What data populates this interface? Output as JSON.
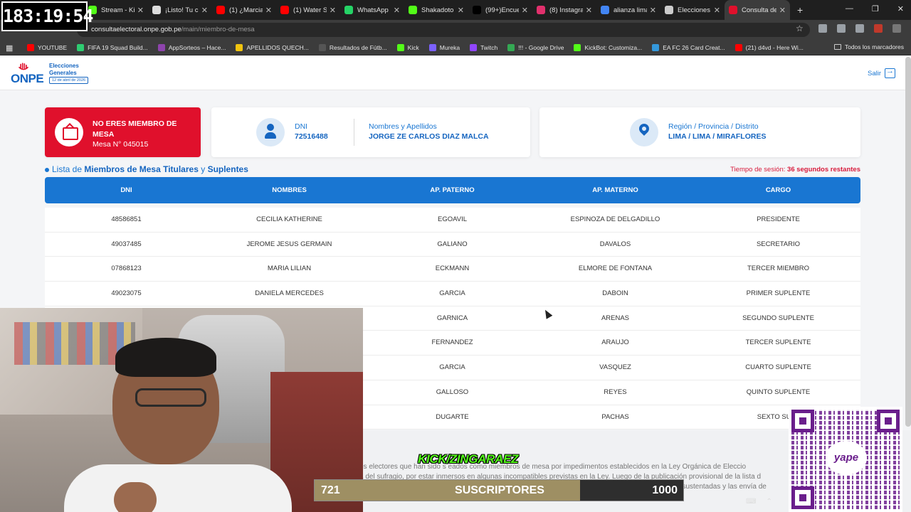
{
  "overlay": {
    "timer": "183:19:54",
    "kick_handle": "KICK/ZINGARAEZ",
    "subs_current": "721",
    "subs_label": "SUSCRIPTORES",
    "subs_goal": "1000",
    "subs_progress_fraction": 0.721,
    "qr_brand": "yape"
  },
  "browser": {
    "tabs": [
      {
        "label": "Stream - Kic",
        "color": "#53fc18"
      },
      {
        "label": "¡Listo! Tu cu",
        "color": "#dddddd"
      },
      {
        "label": "(1) ¿Marcian",
        "color": "#ff0000"
      },
      {
        "label": "(1) Water Sli",
        "color": "#ff0000"
      },
      {
        "label": "WhatsApp |",
        "color": "#25d366"
      },
      {
        "label": "Shakadoto S",
        "color": "#53fc18"
      },
      {
        "label": "(99+)Encuen",
        "color": "#000000"
      },
      {
        "label": "(8) Instagran",
        "color": "#e1306c"
      },
      {
        "label": "alianza lima",
        "color": "#4285f4"
      },
      {
        "label": "Elecciones G",
        "color": "#cccccc"
      },
      {
        "label": "Consulta de",
        "color": "#e0102c",
        "active": true
      }
    ],
    "new_tab": "+",
    "url_domain": "consultaelectoral.onpe.gob.pe",
    "url_path": "/main/miembro-de-mesa",
    "bookmarks": [
      {
        "label": "YOUTUBE",
        "color": "#ff0000"
      },
      {
        "label": "FIFA 19 Squad Build...",
        "color": "#2ecc71"
      },
      {
        "label": "AppSorteos – Hace...",
        "color": "#8e44ad"
      },
      {
        "label": "APELLIDOS QUECH...",
        "color": "#f1c40f"
      },
      {
        "label": "Resultados de Fútb...",
        "color": "#555555"
      },
      {
        "label": "Kick",
        "color": "#53fc18"
      },
      {
        "label": "Mureka",
        "color": "#7b61ff"
      },
      {
        "label": "Twitch",
        "color": "#9146ff"
      },
      {
        "label": "!!! - Google Drive",
        "color": "#34a853"
      },
      {
        "label": "KickBot: Customiza...",
        "color": "#53fc18"
      },
      {
        "label": "EA FC 26 Card Creat...",
        "color": "#3498db"
      },
      {
        "label": "(21) d4vd - Here Wi...",
        "color": "#ff0000"
      }
    ],
    "all_bookmarks": "Todos los marcadores"
  },
  "header": {
    "brand": "ONPE",
    "elections_title": "Elecciones Generales",
    "elections_date": "12 de abril de 2026",
    "logout": "Salir"
  },
  "status_card": {
    "title": "NO ERES MIEMBRO DE MESA",
    "mesa": "Mesa N° 045015"
  },
  "person_card": {
    "dni_label": "DNI",
    "dni_value": "72516488",
    "name_label": "Nombres y Apellidos",
    "name_value": "JORGE ZE CARLOS DIAZ MALCA"
  },
  "location_card": {
    "label": "Región / Provincia / Distrito",
    "value": "LIMA / LIMA / MIRAFLORES"
  },
  "list": {
    "title_prefix": "Lista de",
    "title_bold1": "Miembros de Mesa Titulares",
    "title_mid": "y",
    "title_bold2": "Suplentes",
    "session_prefix": "Tiempo de sesión:",
    "session_value": "36 segundos restantes"
  },
  "table": {
    "columns": [
      "DNI",
      "NOMBRES",
      "AP. PATERNO",
      "AP. MATERNO",
      "CARGO"
    ],
    "rows": [
      [
        "48586851",
        "CECILIA KATHERINE",
        "EGOAVIL",
        "ESPINOZA DE DELGADILLO",
        "PRESIDENTE"
      ],
      [
        "49037485",
        "JEROME JESUS GERMAIN",
        "GALIANO",
        "DAVALOS",
        "SECRETARIO"
      ],
      [
        "07868123",
        "MARIA LILIAN",
        "ECKMANN",
        "ELMORE DE FONTANA",
        "TERCER MIEMBRO"
      ],
      [
        "49023075",
        "DANIELA MERCEDES",
        "GARCIA",
        "DABOIN",
        "PRIMER SUPLENTE"
      ],
      [
        "",
        "",
        "GARNICA",
        "ARENAS",
        "SEGUNDO SUPLENTE"
      ],
      [
        "",
        "",
        "FERNANDEZ",
        "ARAUJO",
        "TERCER SUPLENTE"
      ],
      [
        "",
        "",
        "GARCIA",
        "VASQUEZ",
        "CUARTO SUPLENTE"
      ],
      [
        "",
        "",
        "GALLOSO",
        "REYES",
        "QUINTO SUPLENTE"
      ],
      [
        "",
        "",
        "DUGARTE",
        "PACHAS",
        "SEXTO SUPL"
      ]
    ]
  },
  "notice": {
    "line1": "os electores que han sido s    eados como miembros de mesa por impedimentos establecidos en la Ley Orgánica de Eleccio",
    "line2": "a del sufragio, por estar inmersos en algunas incompatibles previstas en la Ley. Luego de la publicación provisional de la lista d",
    "line3": "erificando que estén debidamente sustentadas y las envía de"
  }
}
